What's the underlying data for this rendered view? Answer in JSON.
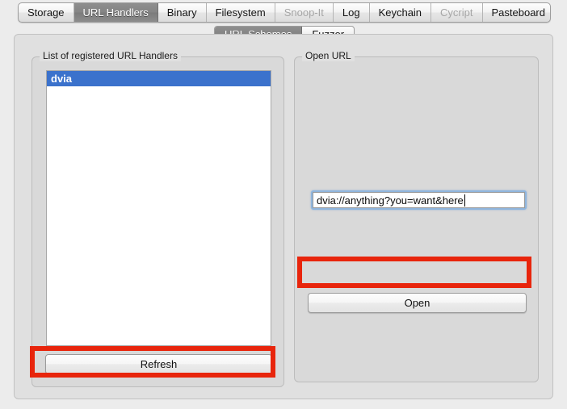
{
  "window": {
    "background_color": "#ececec"
  },
  "main_tabs": [
    {
      "label": "Storage",
      "state": "normal"
    },
    {
      "label": "URL Handlers",
      "state": "selected"
    },
    {
      "label": "Binary",
      "state": "normal"
    },
    {
      "label": "Filesystem",
      "state": "normal"
    },
    {
      "label": "Snoop-It",
      "state": "disabled"
    },
    {
      "label": "Log",
      "state": "normal"
    },
    {
      "label": "Keychain",
      "state": "normal"
    },
    {
      "label": "Cycript",
      "state": "disabled"
    },
    {
      "label": "Pasteboard",
      "state": "normal"
    }
  ],
  "sub_tabs": [
    {
      "label": "URL Schemes",
      "state": "selected"
    },
    {
      "label": "Fuzzer",
      "state": "normal"
    }
  ],
  "left_panel": {
    "title": "List of registered URL Handlers",
    "list_items": [
      {
        "label": "dvia",
        "selected": true
      }
    ],
    "refresh_button_label": "Refresh"
  },
  "right_panel": {
    "title": "Open URL",
    "url_input": {
      "value": "dvia://anything?you=want&here",
      "placeholder": "",
      "focused": true
    },
    "open_button_label": "Open"
  },
  "annotations": {
    "color": "#e8250c",
    "boxes": [
      {
        "target": "refresh-button"
      },
      {
        "target": "open-button"
      }
    ]
  },
  "colors": {
    "selection_blue": "#3b72cc",
    "tab_selected_gray": "#848484",
    "annotation_red": "#e8250c",
    "panel_gray": "#e0e0e0",
    "group_gray": "#d9d9d9"
  }
}
